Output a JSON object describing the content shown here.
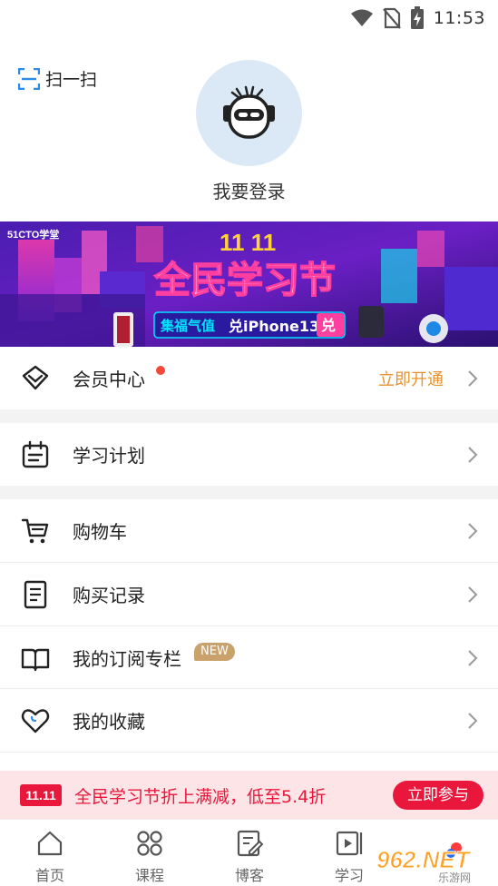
{
  "status_bar": {
    "time": "11:53",
    "icons": [
      "wifi-icon",
      "no-sim-icon",
      "battery-charging-icon"
    ]
  },
  "header": {
    "scan_label": "扫一扫",
    "login_label": "我要登录",
    "avatar_icon": "robot-avatar-icon"
  },
  "banner": {
    "brand": "51CTO学堂",
    "date_text": "11 11",
    "headline": "全民学习节",
    "sub_prefix": "集福气值",
    "sub_main": "兑iPhone13",
    "sub_button": "兑"
  },
  "menu": {
    "items": [
      {
        "label": "会员中心",
        "icon": "diamond-icon",
        "extra": "立即开通",
        "dot": true
      },
      {
        "label": "学习计划",
        "icon": "calendar-plan-icon"
      },
      {
        "label": "购物车",
        "icon": "cart-icon"
      },
      {
        "label": "购买记录",
        "icon": "document-icon"
      },
      {
        "label": "我的订阅专栏",
        "icon": "book-icon",
        "badge": "NEW"
      },
      {
        "label": "我的收藏",
        "icon": "heart-icon"
      }
    ]
  },
  "promo": {
    "tag": "11.11",
    "text": "全民学习节折上满减，低至5.4折",
    "button": "立即参与"
  },
  "tabbar": {
    "tabs": [
      {
        "label": "首页",
        "icon": "home-icon"
      },
      {
        "label": "课程",
        "icon": "grid-icon"
      },
      {
        "label": "博客",
        "icon": "edit-icon"
      },
      {
        "label": "学习",
        "icon": "play-icon"
      }
    ]
  },
  "watermark": {
    "text": "962.NET",
    "sub": "乐游网"
  },
  "colors": {
    "accent_orange": "#e8922f",
    "promo_red": "#e8173b",
    "badge_gold": "#c9a26b",
    "scan_blue": "#2b8be6"
  }
}
